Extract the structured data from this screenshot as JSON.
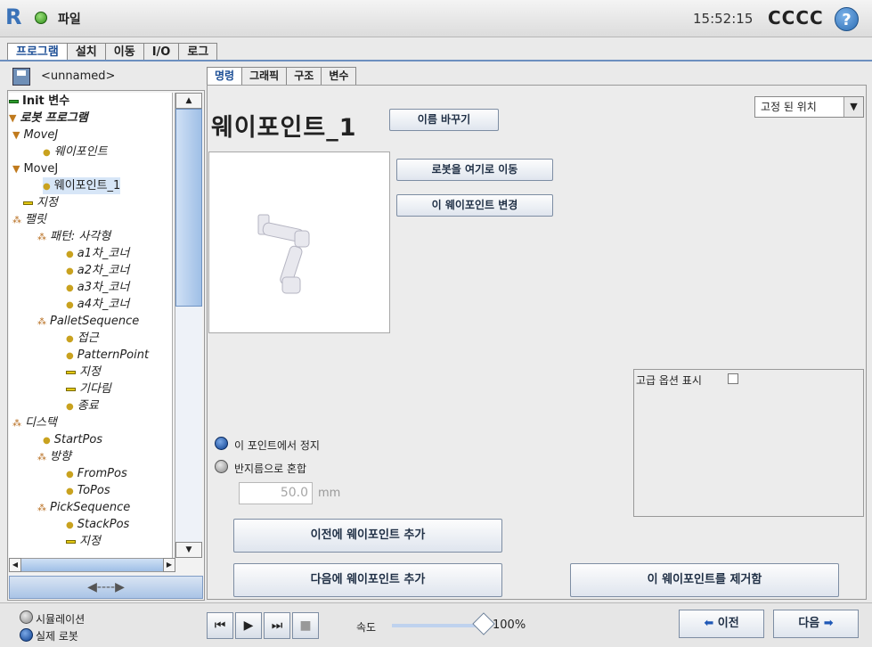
{
  "titlebar": {
    "file_menu": "파일",
    "clock": "15:52:15",
    "robot_name": "CCCC",
    "help": "?"
  },
  "top_tabs": [
    "프로그램",
    "설치",
    "이동",
    "I/O",
    "로그"
  ],
  "program": {
    "name": "<unnamed>"
  },
  "tree": [
    "Init 변수",
    "로봇 프로그램",
    "MoveJ",
    "웨이포인트",
    "MoveJ",
    "웨이포인트_1",
    "지정",
    "팰릿",
    "패턴: 사각형",
    "a1차_코너",
    "a2차_코너",
    "a3차_코너",
    "a4차_코너",
    "PalletSequence",
    "접근",
    "PatternPoint",
    "지정",
    "기다림",
    "종료",
    "디스택",
    "StartPos",
    "방향",
    "FromPos",
    "ToPos",
    "PickSequence",
    "StackPos",
    "지정"
  ],
  "sub_tabs": [
    "명령",
    "그래픽",
    "구조",
    "변수"
  ],
  "waypoint": {
    "title": "웨이포인트_1",
    "rename": "이름 바꾸기",
    "position_type": "고정 된 위치",
    "move_here": "로봇을 여기로 이동",
    "change_waypoint": "이 웨이포인트 변경",
    "advanced_options": "고급 옵션 표시",
    "stop_at_point": "이 포인트에서 정지",
    "blend_radius": "반지름으로 혼합",
    "blend_value": "50.0",
    "blend_unit": "mm",
    "add_before": "이전에 웨이포인트 추가",
    "add_after": "다음에 웨이포인트 추가",
    "remove": "이 웨이포인트를 제거함"
  },
  "footer": {
    "simulation": "시뮬레이션",
    "real_robot": "실제 로봇",
    "speed_label": "속도",
    "speed_value": "100%",
    "prev": "이전",
    "next": "다음"
  },
  "colors": {
    "accent": "#1d4f96",
    "status_ok": "#2f8f1a"
  }
}
